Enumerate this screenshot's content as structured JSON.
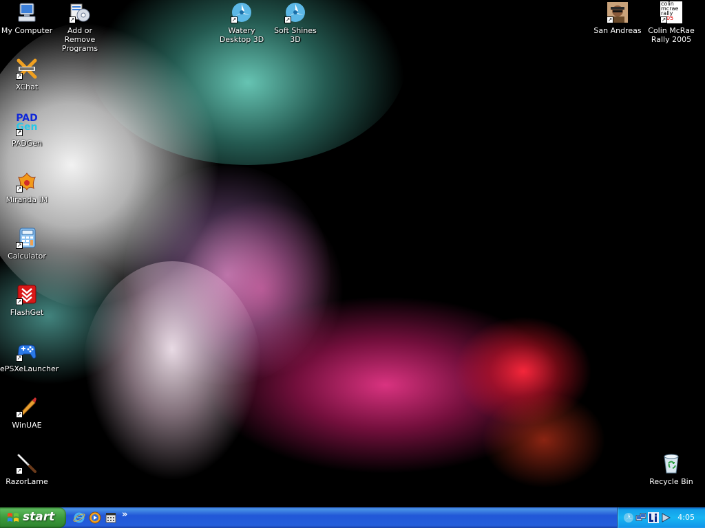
{
  "desktop": {
    "icons": [
      {
        "label": "My Computer",
        "icon": "my-computer-icon"
      },
      {
        "label": "Add or Remove Programs",
        "icon": "add-remove-programs-icon"
      },
      {
        "label": "Watery Desktop 3D",
        "icon": "watery-desktop-icon"
      },
      {
        "label": "Soft Shines 3D",
        "icon": "soft-shines-icon"
      },
      {
        "label": "San Andreas",
        "icon": "san-andreas-icon"
      },
      {
        "label": "Colin McRae Rally 2005",
        "icon": "colin-mcrae-icon"
      },
      {
        "label": "XChat",
        "icon": "xchat-icon"
      },
      {
        "label": "PADGen",
        "icon": "padgen-icon"
      },
      {
        "label": "Miranda IM",
        "icon": "miranda-icon"
      },
      {
        "label": "Calculator",
        "icon": "calculator-icon"
      },
      {
        "label": "FlashGet",
        "icon": "flashget-icon"
      },
      {
        "label": "ePSXeLauncher",
        "icon": "gamepad-icon"
      },
      {
        "label": "WinUAE",
        "icon": "winuae-icon"
      },
      {
        "label": "RazorLame",
        "icon": "razorlame-icon"
      },
      {
        "label": "Recycle Bin",
        "icon": "recycle-bin-icon"
      }
    ],
    "colin_logo_lines": [
      "colin",
      "mcrae",
      "rally",
      "05"
    ],
    "padgen_logo_lines": [
      "PAD",
      "Gen"
    ]
  },
  "taskbar": {
    "start_label": "start",
    "quick_launch_more": "»",
    "clock": "4:05"
  },
  "colors": {
    "taskbar_blue": "#245edb",
    "start_green": "#3c9a3c",
    "tray_blue": "#18b5f2"
  }
}
